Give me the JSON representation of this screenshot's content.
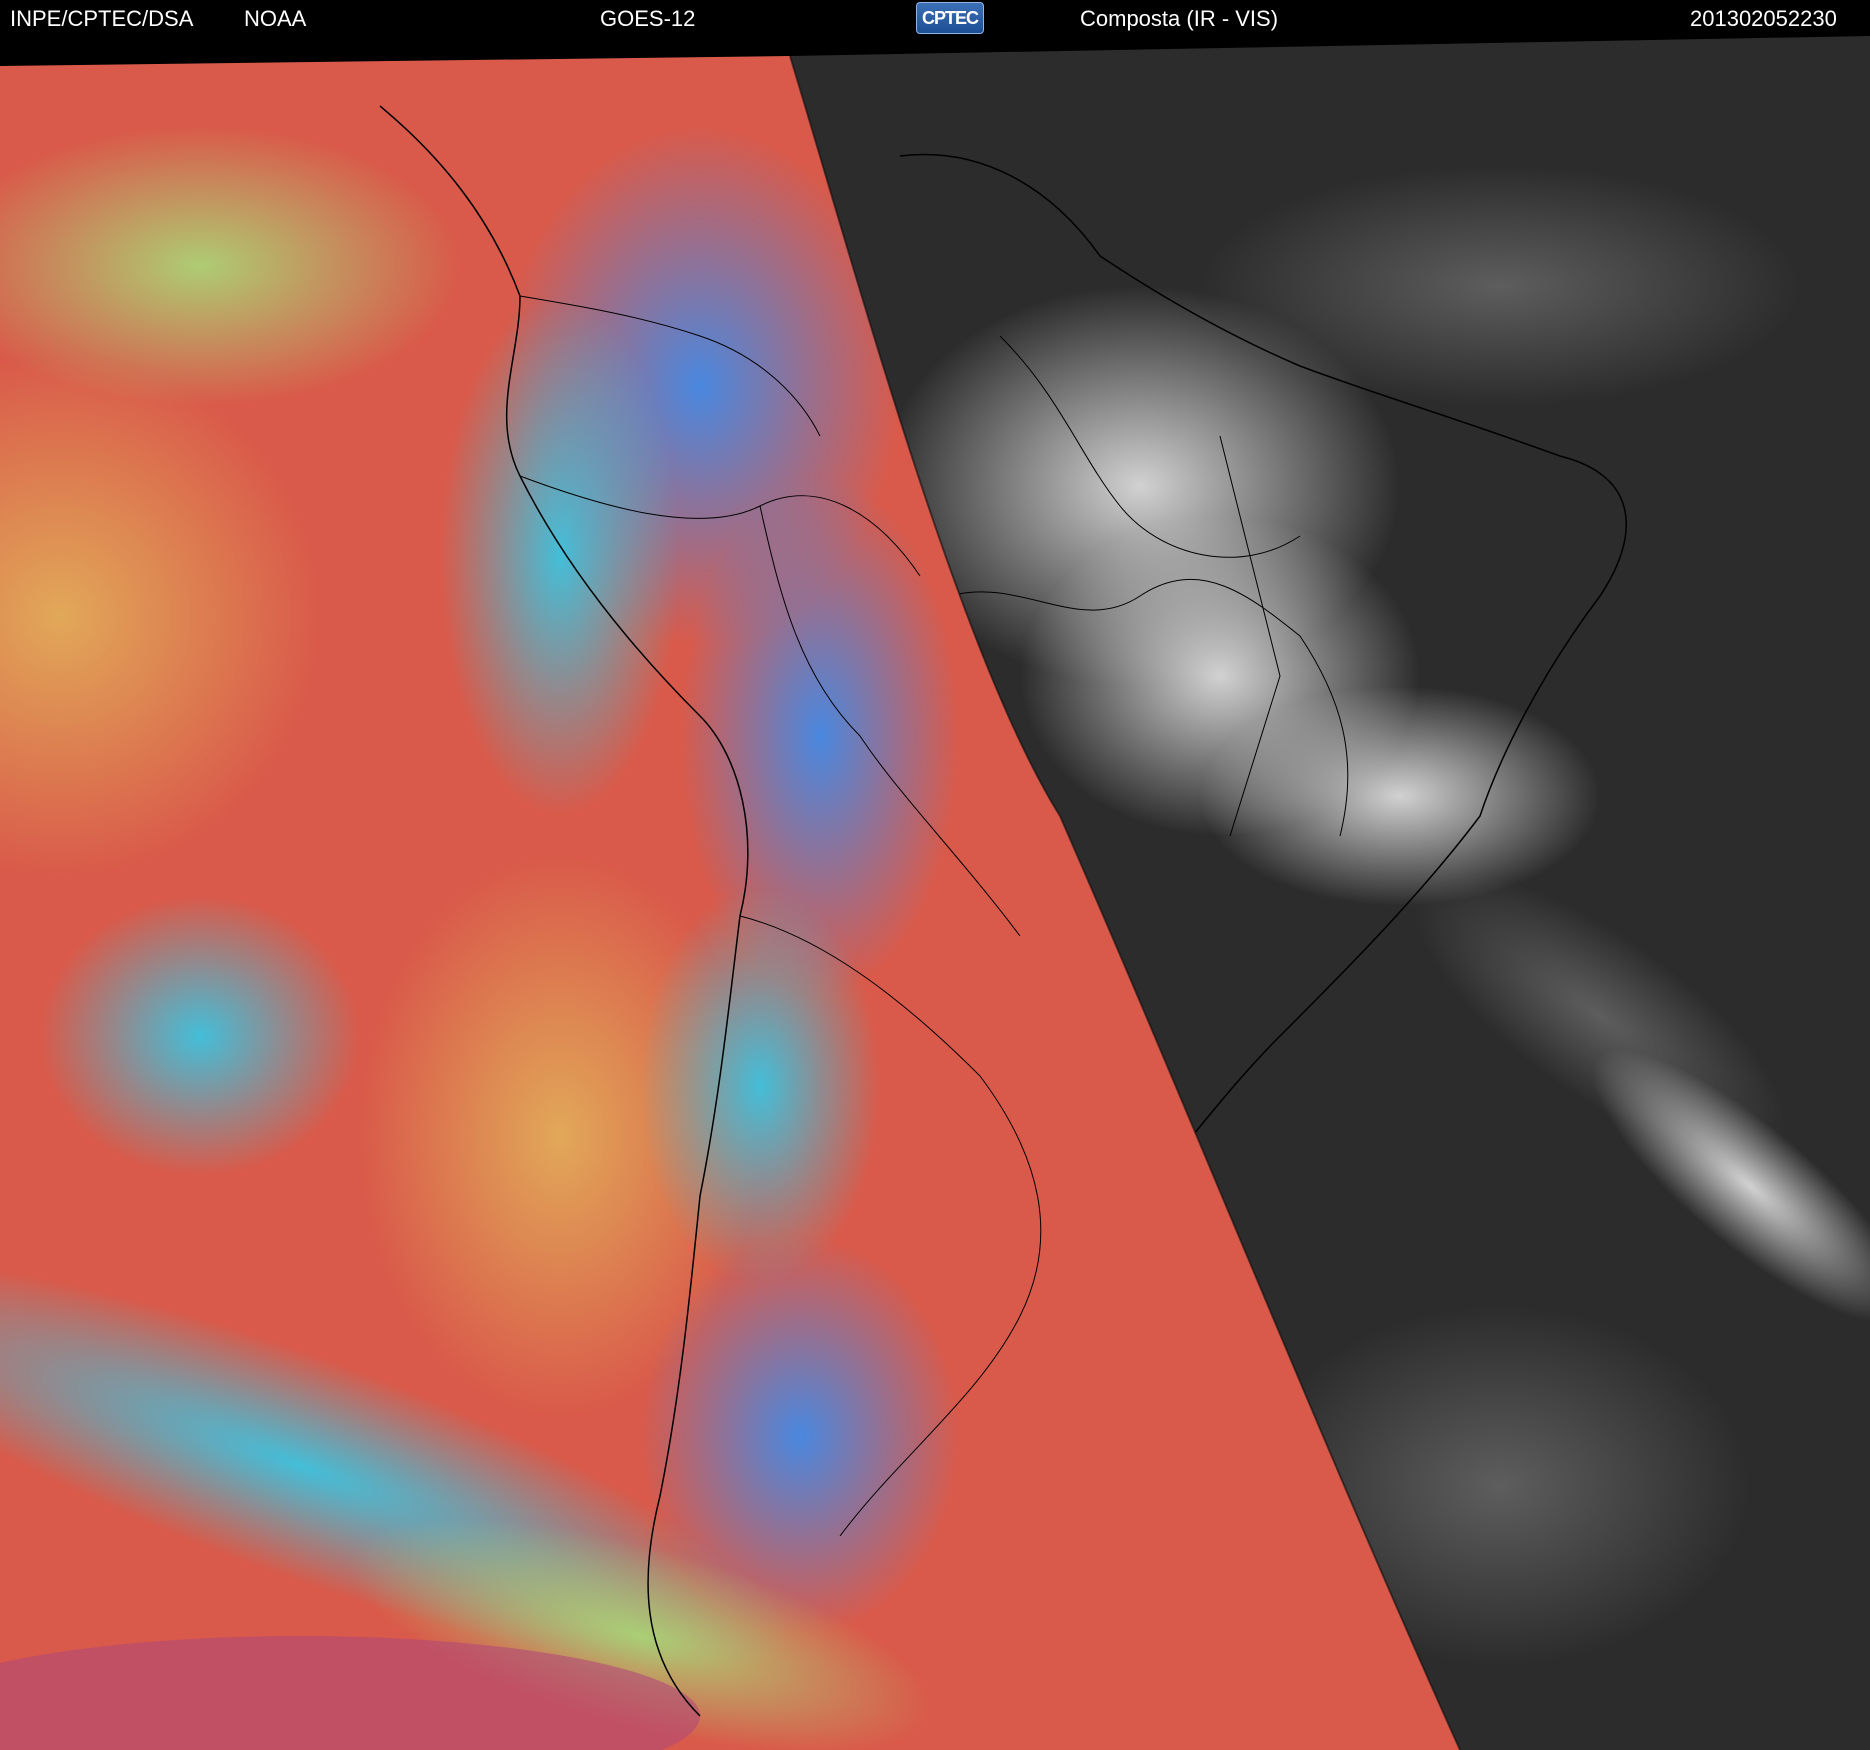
{
  "header": {
    "agency": "INPE/CPTEC/DSA",
    "source": "NOAA",
    "satellite": "GOES-12",
    "logo_text": "CPTEC",
    "product": "Composta (IR - VIS)",
    "timestamp": "201302052230"
  },
  "imagery": {
    "ir_panel_colors": [
      "#d95a4a",
      "#e2b15a",
      "#a6e07a",
      "#33c9e8",
      "#3a8df0",
      "#b04a78"
    ],
    "vis_panel_colors": [
      "#2a2a2a",
      "#4a4a4a",
      "#d8d8d8"
    ],
    "boundary_color": "#000000"
  }
}
